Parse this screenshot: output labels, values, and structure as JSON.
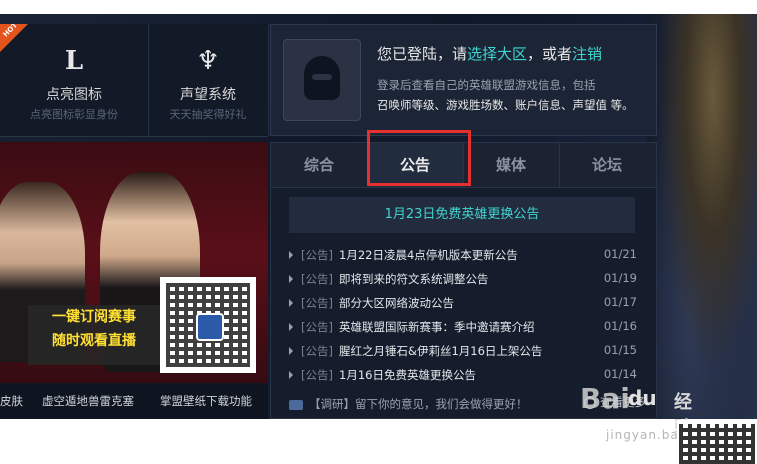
{
  "features": [
    {
      "big": "L",
      "title": "点亮图标",
      "sub": "点亮图标彰显身份",
      "hot": true
    },
    {
      "big": "♆",
      "title": "声望系统",
      "sub": "天天抽奖得好礼",
      "hot": false
    }
  ],
  "hot_label": "HOT",
  "login": {
    "prefix": "您已登陆，请",
    "select_link": "选择大区",
    "mid": "，或者",
    "logout_link": "注销",
    "info_line1": "登录后查看自己的英雄联盟游戏信息，包括",
    "info_line2": "召唤师等级、游戏胜场数、账户信息、声望值 等。"
  },
  "banner": {
    "slogan1": "一键订阅赛事",
    "slogan2": "随时观看直播",
    "links": [
      "皮肤",
      "虚空遁地兽雷克塞",
      "掌盟壁纸下载功能"
    ]
  },
  "tabs": [
    "综合",
    "公告",
    "媒体",
    "论坛"
  ],
  "active_tab": 1,
  "news": {
    "headline": "1月23日免费英雄更换公告",
    "items": [
      {
        "tag": "[公告]",
        "title": "1月22日凌晨4点停机版本更新公告",
        "date": "01/21"
      },
      {
        "tag": "[公告]",
        "title": "即将到来的符文系统调整公告",
        "date": "01/19"
      },
      {
        "tag": "[公告]",
        "title": "部分大区网络波动公告",
        "date": "01/17"
      },
      {
        "tag": "[公告]",
        "title": "英雄联盟国际新赛事：季中邀请赛介绍",
        "date": "01/16"
      },
      {
        "tag": "[公告]",
        "title": "腥红之月锤石&伊莉丝1月16日上架公告",
        "date": "01/15"
      },
      {
        "tag": "[公告]",
        "title": "1月16日免费英雄更换公告",
        "date": "01/14"
      }
    ],
    "feedback": "【调研】留下你的意见，我们会做得更好！",
    "more": "查看更多"
  },
  "watermark": {
    "logo": "Bai",
    "logo2": "经验",
    "du": "du",
    "url": "jingyan.baidu.com"
  },
  "colors": {
    "accent": "#3fd5d0",
    "highlight_box": "#e63030",
    "slogan": "#ffe033"
  }
}
